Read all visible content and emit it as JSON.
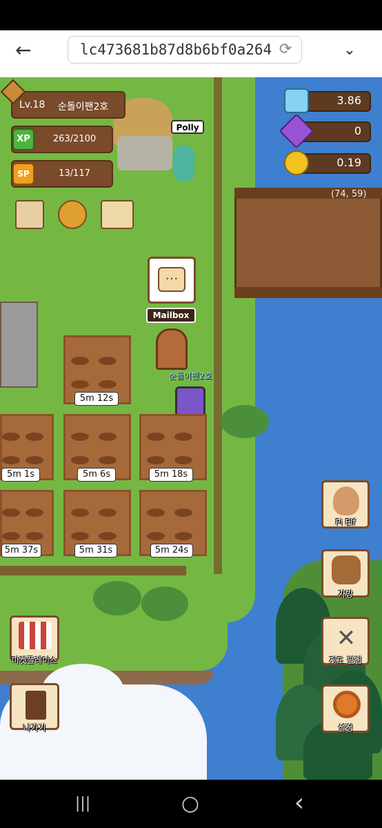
{
  "browser": {
    "back_icon": "←",
    "url": "lc473681b87d8b6bf0a264",
    "reload_icon": "⟳",
    "menu_icon": "⌄"
  },
  "player": {
    "level": "Lv.18",
    "name": "순돌이팬2호",
    "xp": "263/2100",
    "xp_label": "XP",
    "sp": "13/117",
    "sp_label": "SP"
  },
  "resources": {
    "crystal": "3.86",
    "gem": "0",
    "coin": "0.19"
  },
  "coords": "(74, 59)",
  "npc": {
    "polly": "Polly",
    "mailbox": "Mailbox",
    "mailbox_bubble": "···",
    "avatar_name": "순돌이팬2호"
  },
  "plots": {
    "top": "5m 12s",
    "r1": [
      "5m 1s",
      "5m 6s",
      "5m 18s"
    ],
    "r2": [
      "5m 37s",
      "5m 31s",
      "5m 24s"
    ]
  },
  "side_buttons": {
    "pi_elf": "Pi Elf",
    "bag": "가방",
    "map_edit": "지도 편집",
    "settings": "설정",
    "marketplace": "마켓플레이스",
    "exit": "나가기"
  },
  "system_nav": {
    "recents": "|||",
    "home": "○",
    "back": "‹"
  }
}
